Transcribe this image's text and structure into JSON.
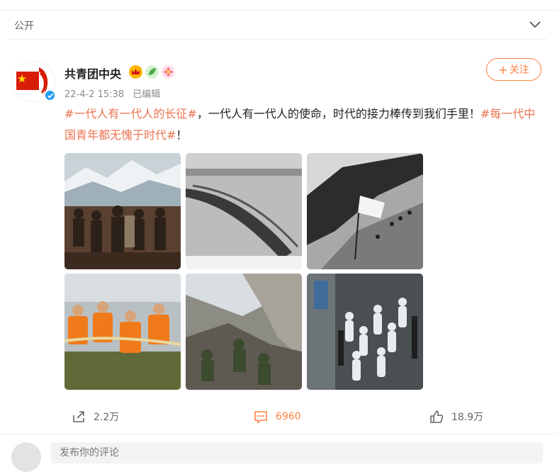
{
  "visibility": {
    "label": "公开"
  },
  "post": {
    "author": "共青团中央",
    "timestamp": "22-4-2 15:38",
    "edited": "已编辑",
    "follow_label": "关注",
    "follow_plus": "+",
    "text_parts": {
      "tag1": "#一代人有一代人的长征#",
      "body": "，一代人有一代人的使命，时代的接力棒传到我们手里！",
      "tag2": "#每一代中国青年都无愧于时代#",
      "end": "！"
    },
    "images": [
      "long-march-painting",
      "troops-crossing-river",
      "flag-on-mountain-ridge",
      "flood-rescue-rope",
      "soldiers-in-rubble",
      "medical-workers-in-protective-suits"
    ]
  },
  "actions": {
    "share_count": "2.2万",
    "comment_count": "6960",
    "like_count": "18.9万"
  },
  "comment_box": {
    "placeholder": "发布你的评论"
  },
  "colors": {
    "accent": "#ff8140",
    "hashtag": "#eb7350",
    "verify": "#1d9bf0"
  },
  "icons": [
    "chevron-down-icon",
    "verified-icon",
    "crown-badge-icon",
    "leaf-badge-icon",
    "flower-badge-icon",
    "share-icon",
    "comment-icon",
    "like-icon"
  ]
}
